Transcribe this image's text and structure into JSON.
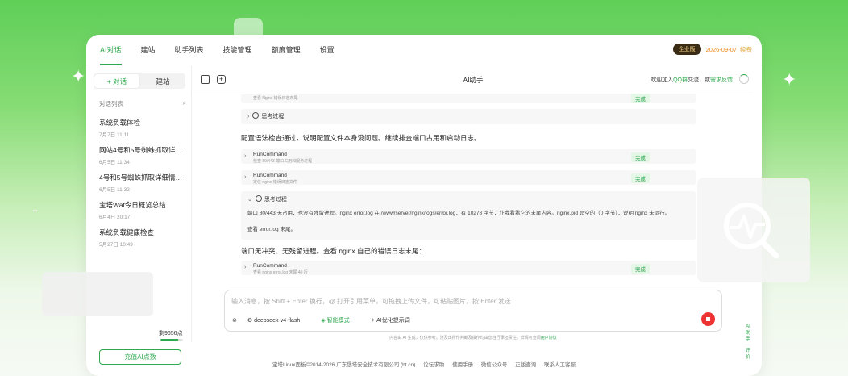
{
  "nav": {
    "items": [
      "AI对话",
      "建站",
      "助手列表",
      "技能管理",
      "额度管理",
      "设置"
    ],
    "active": 0
  },
  "topright": {
    "badge": "企业版",
    "expire": "2026-09-07",
    "renew": "续费"
  },
  "sidebar": {
    "tab_chat": "+ 对话",
    "tab_build": "建站",
    "list_title": "对话列表",
    "conversations": [
      {
        "title": "系统负载体检",
        "date": "7月7日 11:11"
      },
      {
        "title": "网站4号和5号蜘蛛抓取详…",
        "date": "6月5日 11:34"
      },
      {
        "title": "4号和5号蜘蛛抓取详细情…",
        "date": "6月5日 11:32"
      },
      {
        "title": "宝塔Waf今日概览总结",
        "date": "6月4日 20:17"
      },
      {
        "title": "系统负载健康检查",
        "date": "5月27日 10:49"
      }
    ],
    "points_text": "剩9656点",
    "points_ratio": 0.8,
    "recharge_label": "充值AI点数"
  },
  "main": {
    "title": "AI助手",
    "join_prefix": "欢迎加入",
    "join_qq": "QQ群",
    "join_mid": "交流，或",
    "join_feedback": "需求反馈",
    "top_card_sub": "查看 Nginx 错误日志末尾",
    "think_label": "思考过程",
    "para1": "配置语法检查通过，说明配置文件本身没问题。继续排查端口占用和启动日志。",
    "cards": [
      {
        "name": "RunCommand",
        "sub": "检查 80/443 端口占用和服务进程",
        "status": "完成"
      },
      {
        "name": "RunCommand",
        "sub": "定位 nginx 错误日志文件",
        "status": "完成"
      }
    ],
    "think_body1": "端口 80/443 无占用，也没有残留进程。nginx error.log 在 /www/server/nginx/logs/error.log，有 10278 字节，让我看看它的末尾内容。nginx.pid 是空的（0 字节），说明 nginx 未运行。",
    "think_body2": "查看 error.log 末尾。",
    "para2": "端口无冲突、无残留进程。查看 nginx 自己的错误日志末尾：",
    "card3": {
      "name": "RunCommand",
      "sub": "查看 nginx error.log 末尾 40 行",
      "status": "完成"
    },
    "done": "完成"
  },
  "input": {
    "placeholder": "输入消息，按 Shift + Enter 换行，@ 打开引用菜单，可拖拽上传文件，可粘贴图片，按 Enter 发送",
    "model": "deepseek-v4-flash",
    "smart": "智能模式",
    "optimize": "AI优化提示词"
  },
  "disclaimer": {
    "text": "内容由 AI 生成，仅供参考。涉及出所作判断及操作均由您自行承担责任。详情可查阅",
    "link": "用户协议"
  },
  "rail": {
    "ai": "AI助手",
    "eval": "评价"
  },
  "footer": {
    "copyright": "宝塔Linux面板©2014-2026 广东堡塔安全技术有限公司 (bt.cn)",
    "links": [
      "论坛求助",
      "使用手册",
      "微信公众号",
      "正版查询",
      "联系人工客服"
    ]
  }
}
